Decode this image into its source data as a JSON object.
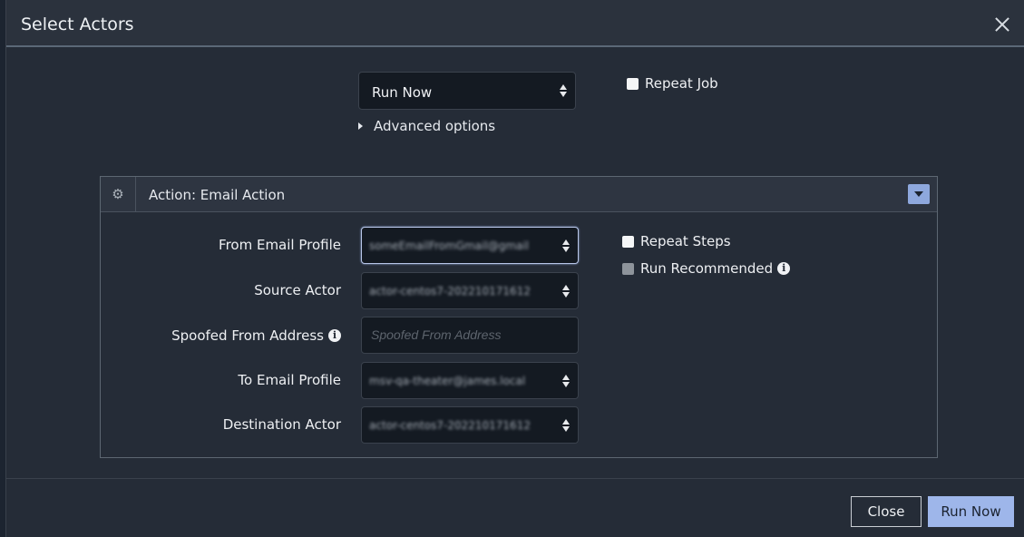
{
  "dialog": {
    "title": "Select Actors",
    "close_icon": "close-icon"
  },
  "schedule": {
    "selected": "Run Now",
    "repeat_job_label": "Repeat Job",
    "advanced_label": "Advanced options"
  },
  "action_panel": {
    "title": "Action: Email Action",
    "gear_icon": "gear-icon",
    "collapse_icon": "caret-down-icon",
    "repeat_steps_label": "Repeat Steps",
    "run_recommended_label": "Run Recommended",
    "fields": {
      "from_email_profile": {
        "label": "From Email Profile",
        "value": "someEmailFromGmail@gmail"
      },
      "source_actor": {
        "label": "Source Actor",
        "value": "actor-centos7-202210171612"
      },
      "spoofed_from": {
        "label": "Spoofed From Address",
        "placeholder": "Spoofed From Address"
      },
      "to_email_profile": {
        "label": "To Email Profile",
        "value": "msv-qa-theater@james.local"
      },
      "destination_actor": {
        "label": "Destination Actor",
        "value": "actor-centos7-202210171612"
      }
    }
  },
  "footer": {
    "close_label": "Close",
    "run_now_label": "Run Now"
  },
  "colors": {
    "accent": "#9eb6ea",
    "background": "#252c37",
    "input_bg": "#141a22"
  }
}
